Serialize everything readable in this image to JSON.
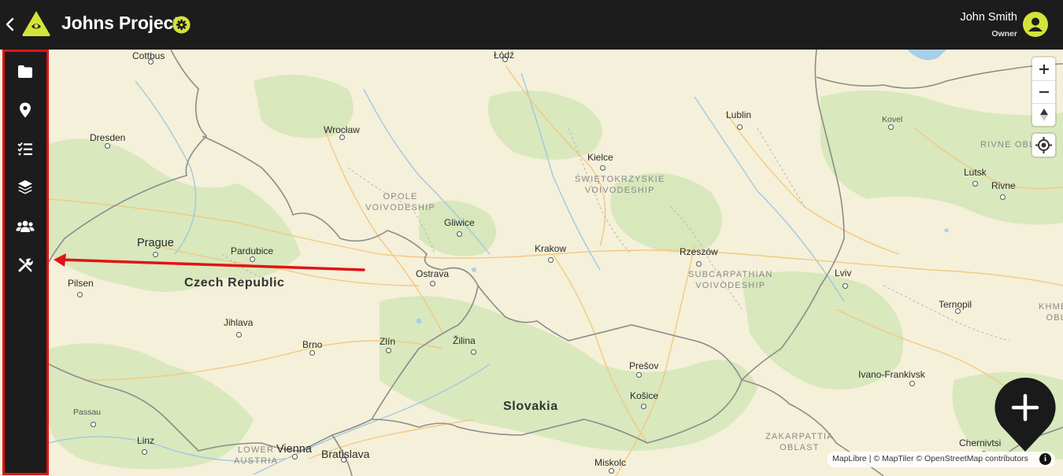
{
  "header": {
    "title": "Johns Project",
    "user_name": "John Smith",
    "user_role": "Owner"
  },
  "icons": {
    "back": "chevron-left-icon",
    "logo": "project-logo",
    "settings": "gear-icon",
    "avatar": "user-icon",
    "sidebar": [
      "folder-icon",
      "map-pin-icon",
      "checklist-icon",
      "layers-icon",
      "users-icon",
      "tools-icon"
    ]
  },
  "colors": {
    "header_bg": "#1c1c1c",
    "accent": "#d4e33a",
    "highlight": "#e01414",
    "map_land": "#f5f0d9",
    "forest": "#cfe3b4"
  },
  "map": {
    "cities": [
      "Cottbus",
      "Łódź",
      "Dresden",
      "Wrocław",
      "Lublin",
      "Kovel",
      "Kielce",
      "Lutsk",
      "Rivne",
      "Gliwice",
      "Prague",
      "Pardubice",
      "Krakow",
      "Rzeszów",
      "Pilsen",
      "Ostrava",
      "Lviv",
      "Ternopil",
      "Jihlava",
      "Brno",
      "Zlín",
      "Žilina",
      "Prešov",
      "Košice",
      "Ivano-Frankivsk",
      "Passau",
      "Linz",
      "Vienna",
      "Bratislava",
      "Miskolc",
      "Chernivtsi"
    ],
    "countries": [
      "Czech Republic",
      "Slovakia"
    ],
    "regions": {
      "opole": "OPOLE\nVOIVODESHIP",
      "swietokrzyskie": "ŚWIĘTOKRZYSKIE\nVOIVODESHIP",
      "subcarpathian": "SUBCARPATHIAN\nVOIVODESHIP",
      "lower_austria": "LOWER\nAUSTRIA",
      "zakarpattia": "ZAKARPATTIA\nOBLAST",
      "rivne_obl": "RIVNE OBLA",
      "khmeln": "KHMELN\nOBLA"
    },
    "attribution": "MapLibre | © MapTiler © OpenStreetMap contributors",
    "attribution_info": "i"
  },
  "controls": {
    "zoom_in": "+",
    "zoom_out": "−",
    "compass": "▲"
  }
}
